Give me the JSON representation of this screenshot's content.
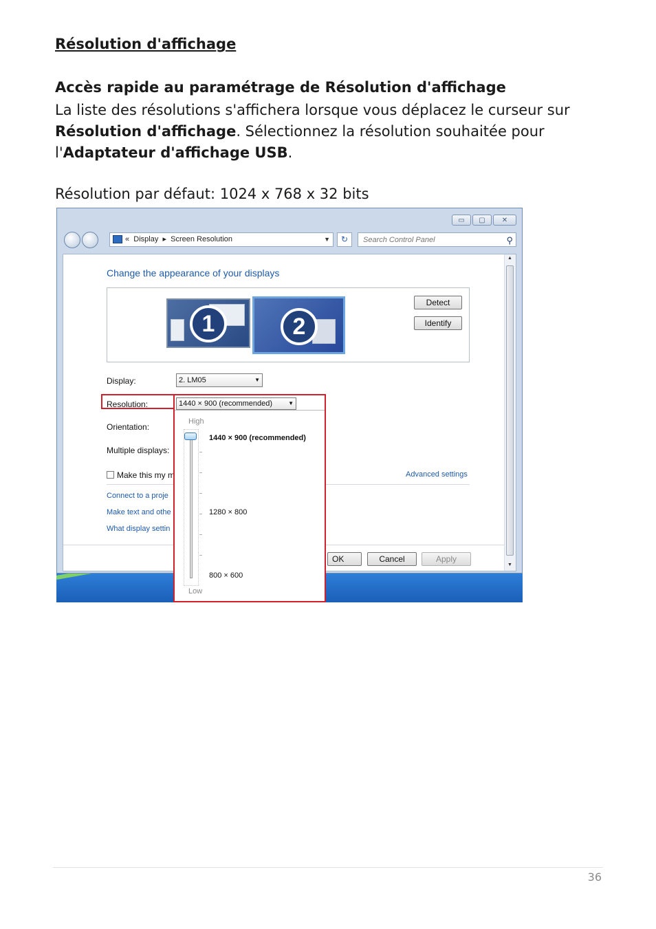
{
  "doc": {
    "heading": "Résolution d'affichage",
    "subheading": "Accès rapide au paramétrage de Résolution d'affichage",
    "para_1": "La liste des résolutions s'affichera lorsque vous déplacez le curseur sur ",
    "para_bold_1": "Résolution d'affichage",
    "para_2": ". Sélectionnez la résolution souhaitée pour l'",
    "para_bold_2": "Adaptateur d'affichage USB",
    "para_3": ".",
    "default_line": "Résolution par défaut: 1024 x 768 x 32 bits",
    "page_number": "36"
  },
  "window": {
    "breadcrumb_sep": "«",
    "breadcrumb_1": "Display",
    "breadcrumb_arrow": "▸",
    "breadcrumb_2": "Screen Resolution",
    "search_placeholder": "Search Control Panel",
    "title": "Change the appearance of your displays",
    "monitor_1": "1",
    "monitor_2": "2",
    "detect_label": "Detect",
    "identify_label": "Identify",
    "display_label": "Display:",
    "display_value": "2. LM05",
    "resolution_label": "Resolution:",
    "resolution_value": "1440 × 900 (recommended)",
    "orientation_label": "Orientation:",
    "multiple_label": "Multiple displays:",
    "make_main_label": "Make this my m",
    "advanced_link": "Advanced settings",
    "link_1": "Connect to a proje",
    "link_2": "Make text and othe",
    "link_3": "What display settin",
    "ok_label": "OK",
    "cancel_label": "Cancel",
    "apply_label": "Apply"
  },
  "popup": {
    "high_label": "High",
    "low_label": "Low",
    "options": [
      "1440 × 900 (recommended)",
      "1280 × 800",
      "800 × 600"
    ],
    "selected_index": 0
  },
  "colors": {
    "highlight_border": "#d0202c",
    "link": "#1e5aa8"
  }
}
